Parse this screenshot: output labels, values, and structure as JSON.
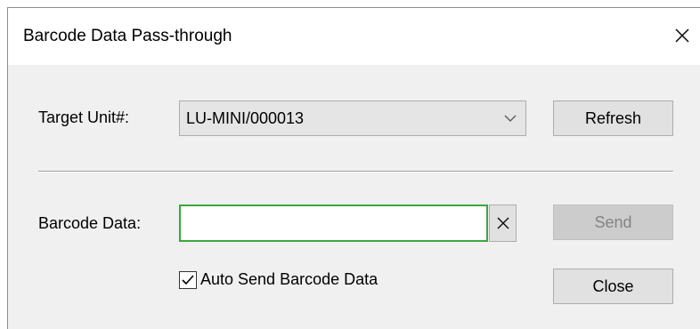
{
  "window": {
    "title": "Barcode Data Pass-through"
  },
  "target_unit": {
    "label": "Target Unit#:",
    "selected": "LU-MINI/000013"
  },
  "buttons": {
    "refresh": "Refresh",
    "send": "Send",
    "close": "Close"
  },
  "barcode": {
    "label": "Barcode Data:",
    "value": ""
  },
  "auto_send": {
    "label": "Auto Send Barcode Data",
    "checked": true
  },
  "colors": {
    "input_focus_border": "#3aa83a",
    "client_background": "#f0f0f0",
    "button_face": "#e1e1e1",
    "disabled_text": "#838383"
  },
  "icons": {
    "close": "close-icon",
    "dropdown": "chevron-down-icon",
    "clear": "clear-x-icon",
    "check": "checkmark-icon"
  }
}
